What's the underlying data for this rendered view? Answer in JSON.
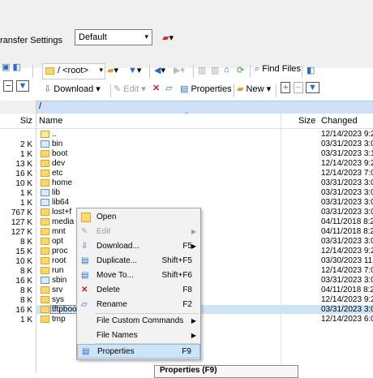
{
  "toolbar": {
    "settings_label": "ransfer Settings",
    "settings_value": "Default",
    "path_value": "/ <root>",
    "find_files": "Find Files",
    "download": "Download",
    "edit": "Edit",
    "properties": "Properties",
    "new": "New"
  },
  "pathbar": {
    "path": "/"
  },
  "columns": {
    "left_size": "Siz",
    "name": "Name",
    "size": "Size",
    "changed": "Changed"
  },
  "left_sizes": [
    "2 K",
    "1 K",
    "13 K",
    "16 K",
    "10 K",
    "1 K",
    "1 K",
    "767 K",
    "127 K",
    "127 K",
    "8 K",
    "15 K",
    "10 K",
    "8 K",
    "16 K",
    "8 K",
    "8 K",
    "16 K",
    "1 K"
  ],
  "files": [
    {
      "name": "..",
      "changed": "12/14/2023 9:2",
      "type": "up"
    },
    {
      "name": "bin",
      "changed": "03/31/2023 3:0",
      "type": "link"
    },
    {
      "name": "boot",
      "changed": "03/31/2023 3:1",
      "type": "folder"
    },
    {
      "name": "dev",
      "changed": "12/14/2023 9:2",
      "type": "folder"
    },
    {
      "name": "etc",
      "changed": "12/14/2023 7:0",
      "type": "folder"
    },
    {
      "name": "home",
      "changed": "03/31/2023 3:0",
      "type": "folder"
    },
    {
      "name": "lib",
      "changed": "03/31/2023 3:0",
      "type": "link"
    },
    {
      "name": "lib64",
      "changed": "03/31/2023 3:0",
      "type": "link"
    },
    {
      "name": "lost+f",
      "changed": "03/31/2023 3:0",
      "type": "folder"
    },
    {
      "name": "media",
      "changed": "04/11/2018 8:2",
      "type": "folder"
    },
    {
      "name": "mnt",
      "changed": "04/11/2018 8:2",
      "type": "folder"
    },
    {
      "name": "opt",
      "changed": "03/31/2023 3:0",
      "type": "folder"
    },
    {
      "name": "proc",
      "changed": "12/14/2023 9:2",
      "type": "folder"
    },
    {
      "name": "root",
      "changed": "03/30/2023 11:",
      "type": "folder"
    },
    {
      "name": "run",
      "changed": "12/14/2023 7:0",
      "type": "folder"
    },
    {
      "name": "sbin",
      "changed": "03/31/2023 3:0",
      "type": "link"
    },
    {
      "name": "srv",
      "changed": "04/11/2018 8:2",
      "type": "folder"
    },
    {
      "name": "sys",
      "changed": "12/14/2023 9:2",
      "type": "folder"
    },
    {
      "name": "tftpboot",
      "changed": "03/31/2023 3:0",
      "type": "folder"
    },
    {
      "name": "tmp",
      "changed": "12/14/2023 6:0",
      "type": "folder"
    }
  ],
  "menu": {
    "open": "Open",
    "edit": "Edit",
    "download": "Download...",
    "download_sc": "F5",
    "duplicate": "Duplicate...",
    "duplicate_sc": "Shift+F5",
    "move": "Move To...",
    "move_sc": "Shift+F6",
    "delete": "Delete",
    "delete_sc": "F8",
    "rename": "Rename",
    "rename_sc": "F2",
    "custom": "File Custom Commands",
    "filenames": "File Names",
    "properties": "Properties",
    "properties_sc": "F9"
  },
  "tooltip": {
    "text": "Properties (F9)"
  },
  "colors": {
    "accent": "#cde4f7",
    "path": "#cfe1f6",
    "folder": "#ffd86b"
  }
}
